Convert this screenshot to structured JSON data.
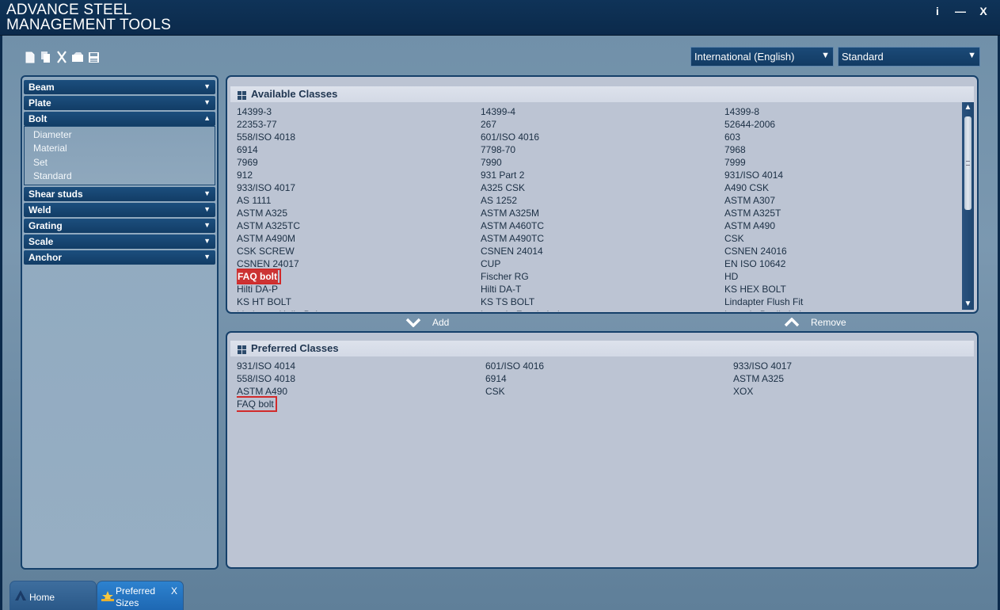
{
  "app": {
    "title_line1": "ADVANCE STEEL",
    "title_line2": "MANAGEMENT TOOLS",
    "info_btn": "i",
    "min_btn": "—",
    "close_btn": "X"
  },
  "toolbar": {
    "icons": [
      "new-icon",
      "copy-icon",
      "cut-icon",
      "paste-icon",
      "save-icon"
    ]
  },
  "selectors": {
    "language": "International (English)",
    "mode": "Standard"
  },
  "sidebar": {
    "categories": [
      {
        "label": "Beam",
        "expanded": false
      },
      {
        "label": "Plate",
        "expanded": false
      },
      {
        "label": "Bolt",
        "expanded": true,
        "items": [
          "Diameter",
          "Material",
          "Set",
          "Standard"
        ]
      },
      {
        "label": "Shear studs",
        "expanded": false
      },
      {
        "label": "Weld",
        "expanded": false
      },
      {
        "label": "Grating",
        "expanded": false
      },
      {
        "label": "Scale",
        "expanded": false
      },
      {
        "label": "Anchor",
        "expanded": false
      }
    ]
  },
  "available": {
    "title": "Available Classes",
    "selected": "FAQ bolt",
    "items": [
      "14399-3",
      "14399-4",
      "14399-8",
      "22353-77",
      "267",
      "52644-2006",
      "558/ISO 4018",
      "601/ISO 4016",
      "603",
      "6914",
      "7798-70",
      "7968",
      "7969",
      "7990",
      "7999",
      "912",
      "931 Part 2",
      "931/ISO 4014",
      "933/ISO 4017",
      "A325 CSK",
      "A490 CSK",
      "AS 1111",
      "AS 1252",
      "ASTM A307",
      "ASTM A325",
      "ASTM A325M",
      "ASTM A325T",
      "ASTM A325TC",
      "ASTM A460TC",
      "ASTM A490",
      "ASTM A490M",
      "ASTM A490TC",
      "CSK",
      "CSK SCREW",
      "CSNEN 24014",
      "CSNEN 24016",
      "CSNEN 24017",
      "CUP",
      "EN ISO 10642",
      "FAQ bolt",
      "Fischer RG",
      "HD",
      "Hilti DA-P",
      "Hilti DA-T",
      "KS HEX BOLT",
      "KS HT BOLT",
      "KS TS BOLT",
      "Lindapter Flush Fit",
      "Lindapter Hollo-Bolt",
      "Lysaght Fazsin bolt",
      "Lysaght Boxlin bolt"
    ]
  },
  "actions": {
    "add": "Add",
    "remove": "Remove"
  },
  "preferred": {
    "title": "Preferred Classes",
    "items": [
      "931/ISO 4014",
      "601/ISO 4016",
      "933/ISO 4017",
      "558/ISO 4018",
      "6914",
      "ASTM A325",
      "ASTM A490",
      "CSK",
      "XOX",
      "FAQ bolt"
    ]
  },
  "tabs": {
    "home": "Home",
    "preferred_line1": "Preferred",
    "preferred_line2": "Sizes",
    "close": "X"
  },
  "colors": {
    "titlebar": "#0b2a4b",
    "accent": "#123d66",
    "highlight": "#d12a2a"
  }
}
